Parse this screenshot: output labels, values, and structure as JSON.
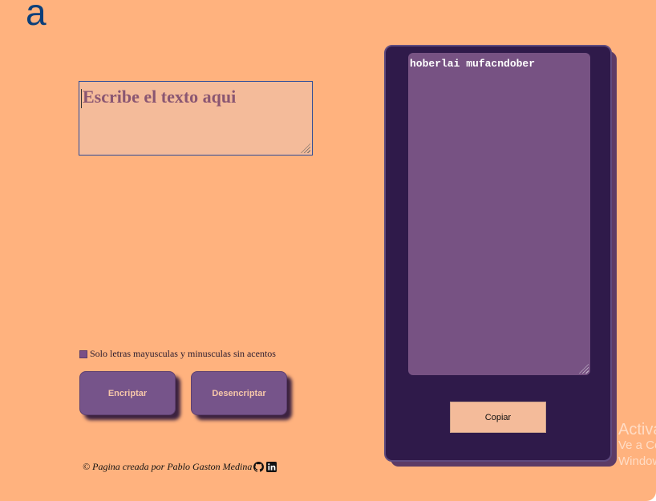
{
  "logo": {
    "glyph": "a"
  },
  "input": {
    "placeholder": "Escribe el texto aqui"
  },
  "hint": {
    "text": "Solo letras mayusculas y minusculas sin acentos"
  },
  "buttons": {
    "encrypt": "Encriptar",
    "decrypt": "Desencriptar",
    "copy": "Copiar"
  },
  "output": {
    "text": "hoberlai mufacndober"
  },
  "footer": {
    "text": "© Pagina creada por Pablo Gaston Medina"
  },
  "watermark": {
    "line1": "Activa",
    "line2": "Ve a Co",
    "line3": "Window"
  },
  "colors": {
    "background": "#ffb27e",
    "panel": "#2f1a4a",
    "output": "#775283",
    "button": "#76548a",
    "input": "#f4bb9a"
  }
}
